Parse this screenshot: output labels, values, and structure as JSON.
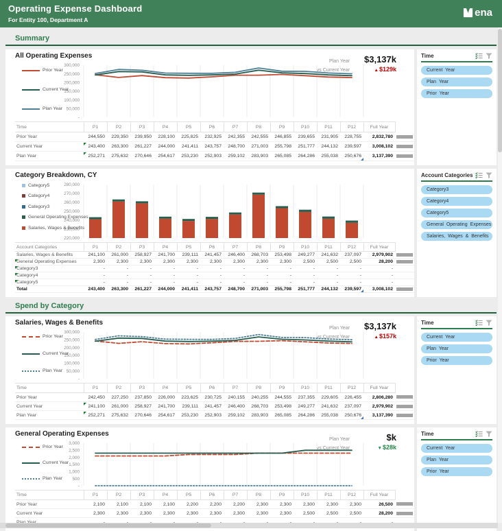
{
  "header": {
    "title": "Operating Expense Dashboard",
    "subtitle": "For Entity 100, Department A",
    "brand": "ena"
  },
  "sections": {
    "summary": "Summary",
    "spend": "Spend by Category"
  },
  "colors": {
    "header_green": "#418159",
    "section_green": "#2e7d4f",
    "prior_year": "#bf4b32",
    "current_year": "#275d51",
    "plan_year": "#4d7f96",
    "bar_salaries": "#c0492f",
    "bar_goe": "#2a5f4e",
    "cat3": "#2f6e8e",
    "cat4": "#843d3a",
    "cat5": "#9bc2e6",
    "pill_blue": "#a9d9f3",
    "delta_up": "#c00000",
    "delta_down": "#1e8a46"
  },
  "time_panel": {
    "title": "Time",
    "items": [
      "Current Year",
      "Plan Year",
      "Prior Year"
    ]
  },
  "account_panel": {
    "title": "Account Categories",
    "items": [
      "Category3",
      "Category4",
      "Category5",
      "General Operating Expenses",
      "Salaries, Wages & Benefits"
    ]
  },
  "cards": {
    "summary": {
      "title": "All Operating Expenses",
      "kpi": {
        "label": "Plan Year",
        "value": "$3,137k",
        "vs_label": "vs Current Year",
        "delta_arrow": "▲",
        "delta": "$129k",
        "direction": "up"
      },
      "legend": [
        {
          "label": "Prior Year",
          "color": "#bf4b32",
          "style": "solid"
        },
        {
          "label": "Current Year",
          "color": "#275d51",
          "style": "solid"
        },
        {
          "label": "Plan Year",
          "color": "#4d7f96",
          "style": "solid"
        }
      ],
      "table": {
        "label_header": "Time",
        "columns": [
          "P1",
          "P2",
          "P3",
          "P4",
          "P5",
          "P6",
          "P7",
          "P8",
          "P9",
          "P10",
          "P11",
          "P12",
          "Full Year"
        ],
        "rows": [
          {
            "label": "Prior Year",
            "values": [
              "244,550",
              "229,350",
              "239,950",
              "228,100",
              "225,825",
              "232,925",
              "242,355",
              "242,555",
              "246,855",
              "239,655",
              "231,905",
              "228,755"
            ],
            "full_year": "2,832,780",
            "bar": true
          },
          {
            "label": "Current Year",
            "values": [
              "243,400",
              "263,300",
              "261,227",
              "244,000",
              "241,411",
              "243,757",
              "248,700",
              "271,003",
              "255,798",
              "251,777",
              "244,132",
              "239,597"
            ],
            "full_year": "3,008,102",
            "bar": true,
            "flag": "p1"
          },
          {
            "label": "Plan Year",
            "values": [
              "252,271",
              "275,632",
              "270,646",
              "254,617",
              "253,230",
              "252,903",
              "259,102",
              "283,903",
              "265,085",
              "264,286",
              "255,038",
              "250,676"
            ],
            "full_year": "3,137,390",
            "bar": true,
            "flag": "p1",
            "end_marker": true
          }
        ]
      }
    },
    "category": {
      "title": "Category Breakdown, CY",
      "legend": [
        {
          "label": "Category5",
          "color": "#9bc2e6",
          "style": "square"
        },
        {
          "label": "Category4",
          "color": "#843d3a",
          "style": "square"
        },
        {
          "label": "Category3",
          "color": "#2f6e8e",
          "style": "square"
        },
        {
          "label": "General Operating Expenses",
          "color": "#2a5f4e",
          "style": "square"
        },
        {
          "label": "Salaries, Wages & Benefits",
          "color": "#c0492f",
          "style": "square"
        }
      ],
      "table": {
        "label_header": "Account Categories",
        "columns": [
          "P1",
          "P2",
          "P3",
          "P4",
          "P5",
          "P6",
          "P7",
          "P8",
          "P9",
          "P10",
          "P11",
          "P12",
          "Full Year"
        ],
        "rows": [
          {
            "label": "Salaries, Wages & Benefits",
            "values": [
              "241,100",
              "261,000",
              "258,927",
              "241,700",
              "239,111",
              "241,457",
              "246,400",
              "268,703",
              "253,498",
              "249,277",
              "241,632",
              "237,097"
            ],
            "full_year": "2,979,902",
            "bar": true
          },
          {
            "label": "General Operating Expenses",
            "values": [
              "2,300",
              "2,300",
              "2,300",
              "2,300",
              "2,300",
              "2,300",
              "2,300",
              "2,300",
              "2,300",
              "2,500",
              "2,500",
              "2,500"
            ],
            "full_year": "28,200",
            "bar": true,
            "flag": "label"
          },
          {
            "label": "Category3",
            "values": [
              "-",
              "-",
              "-",
              "-",
              "-",
              "-",
              "-",
              "-",
              "-",
              "-",
              "-",
              "-"
            ],
            "full_year": "-",
            "flag": "label"
          },
          {
            "label": "Category4",
            "values": [
              "-",
              "-",
              "-",
              "-",
              "-",
              "-",
              "-",
              "-",
              "-",
              "-",
              "-",
              "-"
            ],
            "full_year": "-",
            "flag": "label"
          },
          {
            "label": "Category5",
            "values": [
              "-",
              "-",
              "-",
              "-",
              "-",
              "-",
              "-",
              "-",
              "-",
              "-",
              "-",
              "-"
            ],
            "full_year": "-",
            "flag": "label"
          },
          {
            "label": "Total",
            "values": [
              "243,400",
              "263,300",
              "261,227",
              "244,000",
              "241,411",
              "243,757",
              "248,700",
              "271,003",
              "255,798",
              "251,777",
              "244,132",
              "239,597"
            ],
            "full_year": "3,008,102",
            "bar": true,
            "cls": "total",
            "end_marker": true
          }
        ]
      }
    },
    "salaries": {
      "title": "Salaries, Wages & Benefits",
      "kpi": {
        "label": "Plan Year",
        "value": "$3,137k",
        "vs_label": "vs Current Year",
        "delta_arrow": "▲",
        "delta": "$157k",
        "direction": "up"
      },
      "legend": [
        {
          "label": "Prior Year",
          "color": "#bf4b32",
          "style": "dashed"
        },
        {
          "label": "Current Year",
          "color": "#275d51",
          "style": "solid"
        },
        {
          "label": "Plan Year",
          "color": "#4d7f96",
          "style": "dotted"
        }
      ],
      "table": {
        "label_header": "Time",
        "columns": [
          "P1",
          "P2",
          "P3",
          "P4",
          "P5",
          "P6",
          "P7",
          "P8",
          "P9",
          "P10",
          "P11",
          "P12",
          "Full Year"
        ],
        "rows": [
          {
            "label": "Prior Year",
            "values": [
              "242,450",
              "227,250",
              "237,850",
              "226,000",
              "223,625",
              "230,725",
              "240,155",
              "240,255",
              "244,555",
              "237,355",
              "229,605",
              "226,455"
            ],
            "full_year": "2,806,280",
            "bar": true
          },
          {
            "label": "Current Year",
            "values": [
              "241,100",
              "261,000",
              "258,927",
              "241,700",
              "239,111",
              "241,457",
              "246,400",
              "268,703",
              "253,498",
              "249,277",
              "241,632",
              "237,097"
            ],
            "full_year": "2,979,902",
            "bar": true,
            "flag": "p1"
          },
          {
            "label": "Plan Year",
            "values": [
              "252,271",
              "275,632",
              "270,646",
              "254,617",
              "253,230",
              "252,903",
              "259,102",
              "283,903",
              "265,085",
              "264,286",
              "255,038",
              "250,676"
            ],
            "full_year": "3,137,390",
            "bar": true,
            "flag": "p1",
            "end_marker": true
          }
        ]
      }
    },
    "goe": {
      "title": "General Operating Expenses",
      "kpi": {
        "label": "Plan Year",
        "value": "$k",
        "vs_label": "vs Current Year",
        "delta_arrow": "▼",
        "delta": "$28k",
        "direction": "down"
      },
      "legend": [
        {
          "label": "Prior Year",
          "color": "#bf4b32",
          "style": "dashed"
        },
        {
          "label": "Current Year",
          "color": "#275d51",
          "style": "solid"
        },
        {
          "label": "Plan Year",
          "color": "#4d7f96",
          "style": "dotted"
        }
      ],
      "table": {
        "label_header": "Time",
        "columns": [
          "P1",
          "P2",
          "P3",
          "P4",
          "P5",
          "P6",
          "P7",
          "P8",
          "P9",
          "P10",
          "P11",
          "P12",
          "Full Year"
        ],
        "rows": [
          {
            "label": "Prior Year",
            "values": [
              "2,100",
              "2,100",
              "2,100",
              "2,100",
              "2,200",
              "2,200",
              "2,200",
              "2,300",
              "2,300",
              "2,300",
              "2,300",
              "2,300"
            ],
            "full_year": "26,500",
            "bar": true
          },
          {
            "label": "Current Year",
            "values": [
              "2,300",
              "2,300",
              "2,300",
              "2,300",
              "2,300",
              "2,300",
              "2,300",
              "2,300",
              "2,300",
              "2,500",
              "2,500",
              "2,500"
            ],
            "full_year": "28,200",
            "bar": true
          },
          {
            "label": "Plan Year",
            "values": [
              "-",
              "-",
              "-",
              "-",
              "-",
              "-",
              "-",
              "-",
              "-",
              "-",
              "-",
              "-"
            ],
            "full_year": "-",
            "end_marker": true
          }
        ]
      }
    }
  },
  "chart_data": [
    {
      "id": "summary",
      "type": "line",
      "title": "All Operating Expenses",
      "x": [
        "P1",
        "P2",
        "P3",
        "P4",
        "P5",
        "P6",
        "P7",
        "P8",
        "P9",
        "P10",
        "P11",
        "P12"
      ],
      "ylim": [
        0,
        300000
      ],
      "yticks": [
        300000,
        250000,
        200000,
        150000,
        100000,
        50000,
        0
      ],
      "ytick_labels": [
        "300,000",
        "250,000",
        "200,000",
        "150,000",
        "100,000",
        "50,000",
        "-"
      ],
      "grid": "vertical",
      "legend_position": "left",
      "series": [
        {
          "name": "Prior Year",
          "color": "#bf4b32",
          "style": "solid",
          "values": [
            244550,
            229350,
            239950,
            228100,
            225825,
            232925,
            242355,
            242555,
            246855,
            239655,
            231905,
            228755
          ]
        },
        {
          "name": "Current Year",
          "color": "#275d51",
          "style": "solid",
          "values": [
            243400,
            263300,
            261227,
            244000,
            241411,
            243757,
            248700,
            271003,
            255798,
            251777,
            244132,
            239597
          ]
        },
        {
          "name": "Plan Year",
          "color": "#4d7f96",
          "style": "solid",
          "values": [
            252271,
            275632,
            270646,
            254617,
            253230,
            252903,
            259102,
            283903,
            265085,
            264286,
            255038,
            250676
          ]
        }
      ]
    },
    {
      "id": "category",
      "type": "bar",
      "title": "Category Breakdown, CY",
      "x": [
        "P1",
        "P2",
        "P3",
        "P4",
        "P5",
        "P6",
        "P7",
        "P8",
        "P9",
        "P10",
        "P11",
        "P12"
      ],
      "ylim": [
        220000,
        280000
      ],
      "yticks": [
        280000,
        270000,
        260000,
        250000,
        240000,
        230000,
        220000
      ],
      "ytick_labels": [
        "280,000",
        "270,000",
        "260,000",
        "250,000",
        "240,000",
        "230,000",
        "220,000"
      ],
      "grid": "vertical",
      "legend_position": "left",
      "stacked": true,
      "series": [
        {
          "name": "Salaries, Wages & Benefits",
          "color": "#c0492f",
          "values": [
            241100,
            261000,
            258927,
            241700,
            239111,
            241457,
            246400,
            268703,
            253498,
            249277,
            241632,
            237097
          ]
        },
        {
          "name": "General Operating Expenses",
          "color": "#2a5f4e",
          "values": [
            2300,
            2300,
            2300,
            2300,
            2300,
            2300,
            2300,
            2300,
            2300,
            2500,
            2500,
            2500
          ]
        },
        {
          "name": "Category3",
          "color": "#2f6e8e",
          "values": [
            0,
            0,
            0,
            0,
            0,
            0,
            0,
            0,
            0,
            0,
            0,
            0
          ]
        },
        {
          "name": "Category4",
          "color": "#843d3a",
          "values": [
            0,
            0,
            0,
            0,
            0,
            0,
            0,
            0,
            0,
            0,
            0,
            0
          ]
        },
        {
          "name": "Category5",
          "color": "#9bc2e6",
          "values": [
            0,
            0,
            0,
            0,
            0,
            0,
            0,
            0,
            0,
            0,
            0,
            0
          ]
        }
      ]
    },
    {
      "id": "salaries",
      "type": "line",
      "title": "Salaries, Wages & Benefits",
      "x": [
        "P1",
        "P2",
        "P3",
        "P4",
        "P5",
        "P6",
        "P7",
        "P8",
        "P9",
        "P10",
        "P11",
        "P12"
      ],
      "ylim": [
        0,
        300000
      ],
      "yticks": [
        300000,
        250000,
        200000,
        150000,
        100000,
        50000,
        0
      ],
      "ytick_labels": [
        "300,000",
        "250,000",
        "200,000",
        "150,000",
        "100,000",
        "50,000",
        "-"
      ],
      "grid": "vertical",
      "legend_position": "left",
      "series": [
        {
          "name": "Prior Year",
          "color": "#bf4b32",
          "style": "dashed",
          "values": [
            242450,
            227250,
            237850,
            226000,
            223625,
            230725,
            240155,
            240255,
            244555,
            237355,
            229605,
            226455
          ]
        },
        {
          "name": "Current Year",
          "color": "#275d51",
          "style": "solid",
          "values": [
            241100,
            261000,
            258927,
            241700,
            239111,
            241457,
            246400,
            268703,
            253498,
            249277,
            241632,
            237097
          ]
        },
        {
          "name": "Plan Year",
          "color": "#4d7f96",
          "style": "dotted",
          "values": [
            252271,
            275632,
            270646,
            254617,
            253230,
            252903,
            259102,
            283903,
            265085,
            264286,
            255038,
            250676
          ]
        }
      ]
    },
    {
      "id": "goe",
      "type": "line",
      "title": "General Operating Expenses",
      "x": [
        "P1",
        "P2",
        "P3",
        "P4",
        "P5",
        "P6",
        "P7",
        "P8",
        "P9",
        "P10",
        "P11",
        "P12"
      ],
      "ylim": [
        0,
        3000
      ],
      "yticks": [
        3000,
        2500,
        2000,
        1500,
        1000,
        500,
        0
      ],
      "ytick_labels": [
        "3,000",
        "2,500",
        "2,000",
        "1,500",
        "1,000",
        "500",
        "-"
      ],
      "grid": "vertical",
      "legend_position": "left",
      "series": [
        {
          "name": "Prior Year",
          "color": "#bf4b32",
          "style": "dashed",
          "values": [
            2100,
            2100,
            2100,
            2100,
            2200,
            2200,
            2200,
            2300,
            2300,
            2300,
            2300,
            2300
          ]
        },
        {
          "name": "Current Year",
          "color": "#275d51",
          "style": "solid",
          "values": [
            2300,
            2300,
            2300,
            2300,
            2300,
            2300,
            2300,
            2300,
            2300,
            2500,
            2500,
            2500
          ]
        },
        {
          "name": "Plan Year",
          "color": "#4d7f96",
          "style": "dotted",
          "values": [
            0,
            0,
            0,
            0,
            0,
            0,
            0,
            0,
            0,
            0,
            0,
            0
          ]
        }
      ]
    }
  ]
}
